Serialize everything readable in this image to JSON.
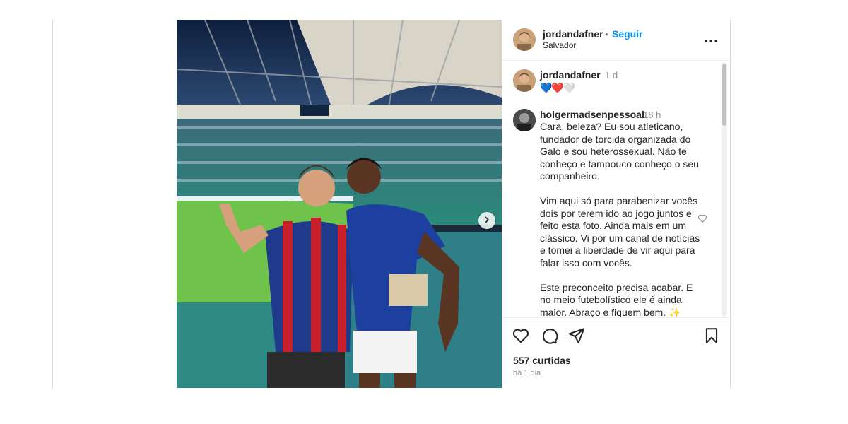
{
  "post": {
    "author": "jordandafner",
    "separator": "•",
    "follow_label": "Seguir",
    "location": "Salvador"
  },
  "caption": {
    "author": "jordandafner",
    "time": "1 d",
    "text": "💙❤️🤍"
  },
  "comment": {
    "author": "holgermadsenpessoal",
    "time": "18 h",
    "paragraphs": [
      "Cara, beleza? Eu sou atleticano, fundador de torcida organizada do Galo e sou heterossexual. Não te conheço e tampouco conheço o seu companheiro.",
      "Vim aqui só para parabenizar vocês dois por terem ido ao jogo juntos e feito esta foto. Ainda mais em um clássico. Vi por um canal de notícias e tomei a liberdade de vir aqui para falar isso com vocês.",
      "Este preconceito precisa acabar. E no meio futebolístico ele é ainda maior. Abraço e fiquem bem. ✨"
    ]
  },
  "stats": {
    "likes": "557 curtidas",
    "time_ago": "há 1 dia"
  },
  "icons": {
    "like": "heart-icon",
    "comment": "comment-icon",
    "share": "share-icon",
    "save": "bookmark-icon",
    "more": "more-icon",
    "next": "chevron-right-icon"
  },
  "colors": {
    "accent": "#0095f6",
    "muted": "#8e8e8e",
    "text": "#262626"
  }
}
